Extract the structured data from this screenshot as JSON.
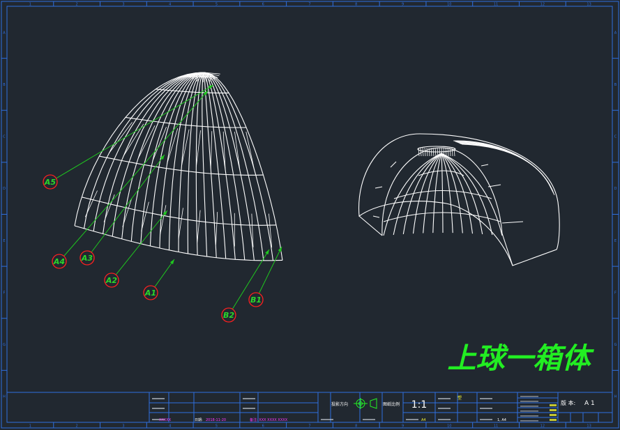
{
  "drawing": {
    "title": "上球一箱体",
    "scale": "1:1",
    "version_label": "版 本:",
    "version_value": "A 1"
  },
  "callouts": [
    {
      "label": "A5"
    },
    {
      "label": "A4"
    },
    {
      "label": "A3"
    },
    {
      "label": "A2"
    },
    {
      "label": "A1"
    },
    {
      "label": "B2"
    },
    {
      "label": "B1"
    }
  ],
  "frame": {
    "top_marks": [
      "1",
      "2",
      "3",
      "4",
      "5",
      "6",
      "7",
      "8",
      "9",
      "10",
      "11",
      "12",
      "13"
    ],
    "side_marks": [
      "A",
      "B",
      "C",
      "D",
      "E",
      "F",
      "G",
      "H"
    ]
  },
  "title_block": {
    "designer": "XXXXX",
    "date_label": "日期:",
    "date_value": "2018-11-20",
    "note": "备注: XXX XXXX XXXX",
    "projection_label": "投影方向",
    "scale_label": "图纸比例",
    "size_value": "A4",
    "sheet_value": "1, A4",
    "material_value": "塑"
  },
  "colors": {
    "background": "#212830",
    "frame": "#2f6fe0",
    "wire": "#ffffff",
    "callout_line": "#1fc81f",
    "callout_circle": "#ff2020",
    "callout_text": "#2bd62b",
    "title": "#22ee22",
    "magenta": "#ff35ff",
    "yellow": "#eeee33"
  }
}
